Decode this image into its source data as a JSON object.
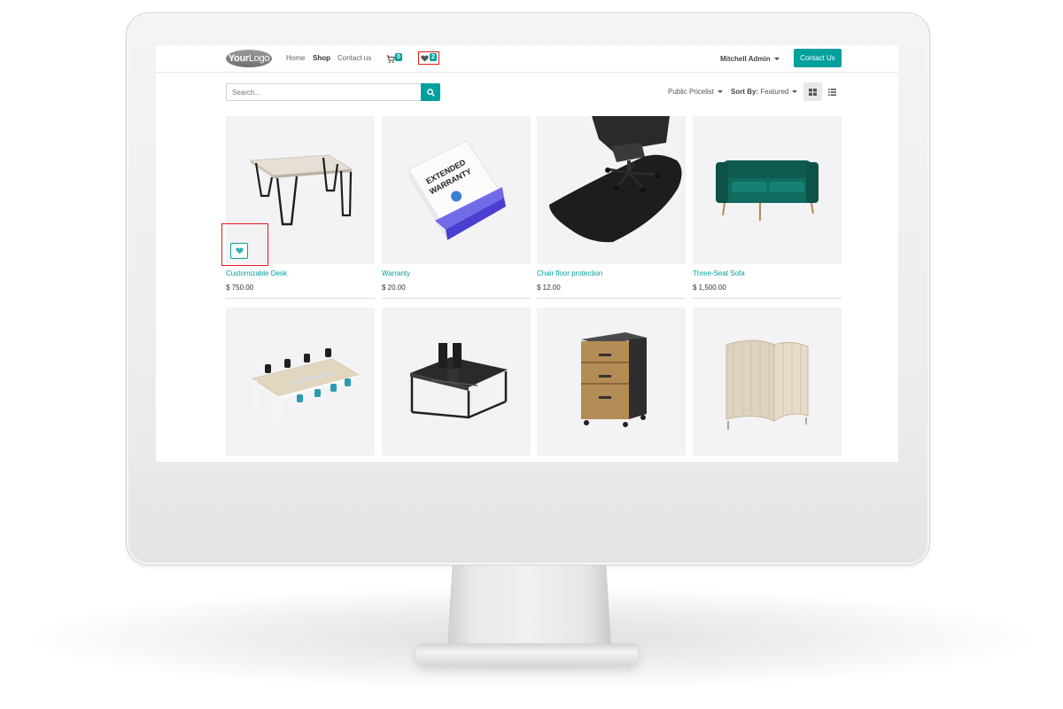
{
  "header": {
    "logo_bold": "Your",
    "logo_light": "Logo",
    "nav": [
      "Home",
      "Shop",
      "Contact us"
    ],
    "cart_count": "0",
    "wishlist_count": "2",
    "user_name": "Mitchell Admin",
    "contact_button": "Contact Us"
  },
  "toolbar": {
    "search_placeholder": "Search...",
    "pricelist_label": "Public Pricelist",
    "sort_label": "Sort By:",
    "sort_value": "Featured"
  },
  "products": [
    {
      "name": "Customizable Desk",
      "price": "$ 750.00"
    },
    {
      "name": "Warranty",
      "price": "$ 20.00"
    },
    {
      "name": "Chair floor protection",
      "price": "$ 12.00"
    },
    {
      "name": "Three-Seat Sofa",
      "price": "$ 1,500.00"
    }
  ],
  "warranty_box_text": [
    "EXTENDED",
    "WARRANTY"
  ],
  "colors": {
    "accent": "#00a09d",
    "highlight": "#e21a1a"
  }
}
